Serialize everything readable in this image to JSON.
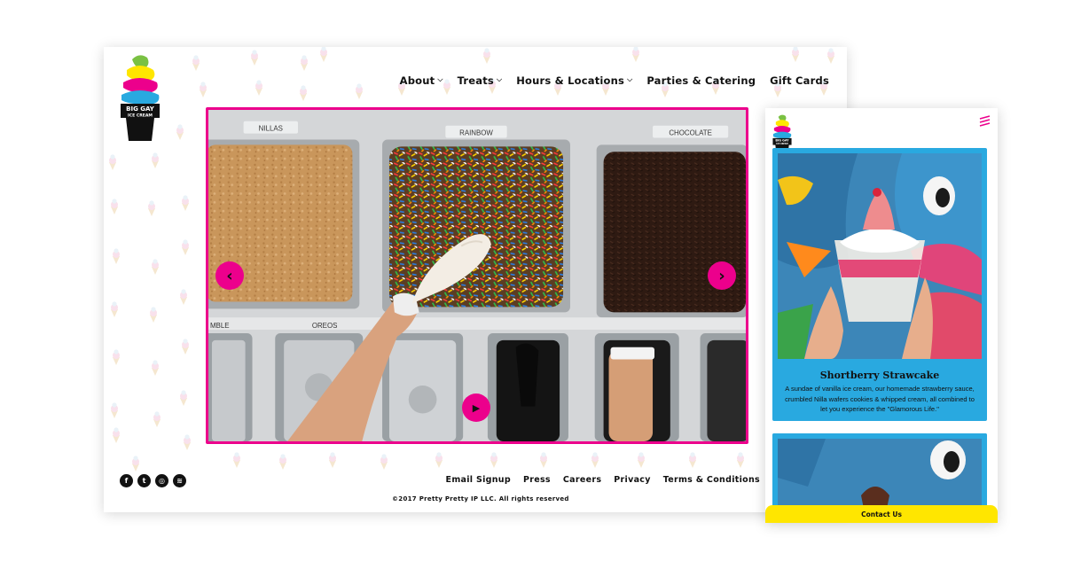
{
  "brand": {
    "logo_line1": "BIG GAY",
    "logo_line2": "ICE CREAM",
    "accent": "#ec008c",
    "blue": "#29a9e0",
    "yellow": "#ffe600"
  },
  "nav": {
    "items": [
      {
        "label": "About",
        "dropdown": true
      },
      {
        "label": "Treats",
        "dropdown": true
      },
      {
        "label": "Hours & Locations",
        "dropdown": true
      },
      {
        "label": "Parties & Catering",
        "dropdown": false
      },
      {
        "label": "Gift Cards",
        "dropdown": false
      }
    ]
  },
  "hero": {
    "bin_labels": [
      "NILLAS",
      "RAINBOW",
      "CHOCOLATE",
      "MBLE",
      "OREOS"
    ],
    "prev_icon": "chevron-left-icon",
    "next_icon": "chevron-right-icon",
    "play_icon": "play-icon"
  },
  "social": {
    "icons": [
      {
        "name": "facebook-icon",
        "glyph": "f"
      },
      {
        "name": "twitter-icon",
        "glyph": "t"
      },
      {
        "name": "instagram-icon",
        "glyph": "◎"
      },
      {
        "name": "spotify-icon",
        "glyph": "≋"
      }
    ]
  },
  "footer": {
    "links": [
      "Email Signup",
      "Press",
      "Careers",
      "Privacy",
      "Terms & Conditions"
    ],
    "copyright": "©2017 Pretty Pretty IP LLC. All rights reserved"
  },
  "mobile": {
    "card_title": "Shortberry Strawcake",
    "card_description": "A sundae of vanilla ice cream, our homemade strawberry sauce, crumbled Nilla wafers cookies & whipped cream, all combined to let you experience the \"Glamorous Life.\"",
    "contact_label": "Contact Us",
    "menu_icon": "hamburger-menu-icon"
  }
}
